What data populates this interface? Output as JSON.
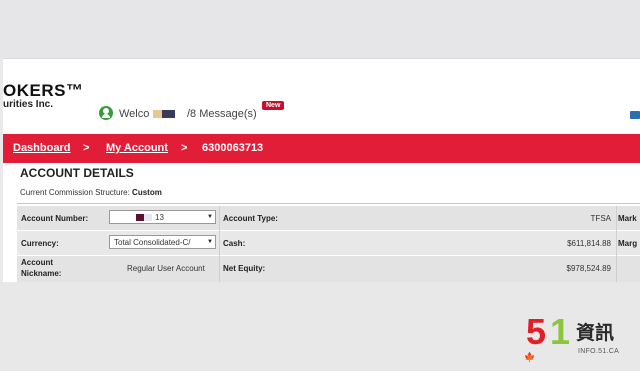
{
  "header": {
    "brand": "OKERS™",
    "brand_sub": "urities Inc.",
    "welcome": "Welco",
    "messages": "/8 Message(s)",
    "new_badge": "New"
  },
  "breadcrumb": {
    "dashboard": "Dashboard",
    "sep1": ">",
    "my_account": "My Account",
    "sep2": ">",
    "account_id": "6300063713"
  },
  "account": {
    "title": "ACCOUNT DETAILS",
    "commission_label": "Current Commission Structure:",
    "commission_value": "Custom",
    "rows": {
      "account_number_label": "Account Number:",
      "account_number_value": "13",
      "account_type_label": "Account Type:",
      "account_type_value": "TFSA",
      "market_label": "Mark",
      "currency_label": "Currency:",
      "currency_value": "Total Consolidated-C/",
      "cash_label": "Cash:",
      "cash_value": "$611,814.88",
      "margin_label": "Marg",
      "nickname_label_1": "Account",
      "nickname_label_2": "Nickname:",
      "nickname_value": "Regular User Account",
      "net_equity_label": "Net Equity:",
      "net_equity_value": "$978,524.89"
    }
  },
  "watermark": {
    "digit_5": "5",
    "digit_1": "1",
    "chinese": "資訊",
    "url": "INFO.51.CA",
    "leaf": "🍁"
  }
}
